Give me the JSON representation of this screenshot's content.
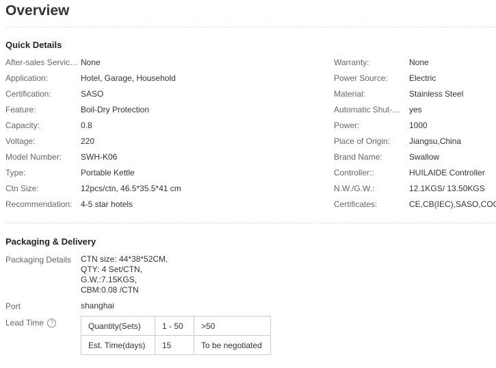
{
  "page_title": "Overview",
  "quick_details": {
    "title": "Quick Details",
    "left": [
      {
        "label": "After-sales Service ...",
        "value": "None"
      },
      {
        "label": "Application:",
        "value": "Hotel, Garage, Household"
      },
      {
        "label": "Certification:",
        "value": "SASO"
      },
      {
        "label": "Feature:",
        "value": "Boil-Dry Protection"
      },
      {
        "label": "Capacity:",
        "value": "0.8"
      },
      {
        "label": "Voltage:",
        "value": "220"
      },
      {
        "label": "Model Number:",
        "value": "SWH-K06"
      },
      {
        "label": "Type:",
        "value": "Portable Kettle"
      },
      {
        "label": "Ctn Size:",
        "value": "12pcs/ctn, 46.5*35.5*41 cm"
      },
      {
        "label": "Recommendation:",
        "value": "4-5 star hotels"
      }
    ],
    "right": [
      {
        "label": "Warranty:",
        "value": "None"
      },
      {
        "label": "Power Source:",
        "value": "Electric"
      },
      {
        "label": "Material:",
        "value": "Stainless Steel"
      },
      {
        "label": "Automatic Shut-off:",
        "value": "yes"
      },
      {
        "label": "Power:",
        "value": "1000"
      },
      {
        "label": "Place of Origin:",
        "value": "Jiangsu,China"
      },
      {
        "label": "Brand Name:",
        "value": "Swallow"
      },
      {
        "label": "Controller::",
        "value": "HUILAIDE Controller"
      },
      {
        "label": "N.W./G.W.:",
        "value": "12.1KGS/ 13.50KGS"
      },
      {
        "label": "Certificates:",
        "value": "CE,CB(IEC),SASO,COC"
      }
    ]
  },
  "packaging": {
    "title": "Packaging & Delivery",
    "details_label": "Packaging Details",
    "details_lines": [
      "CTN size: 44*38*52CM,",
      "QTY: 4 Set/CTN,",
      "G.W.:7.15KGS,",
      "CBM:0.08 /CTN"
    ],
    "port_label": "Port",
    "port_value": "shanghai",
    "lead_time_label": "Lead Time",
    "help_icon": "?",
    "lead_table": {
      "row1": [
        "Quantity(Sets)",
        "1 - 50",
        ">50"
      ],
      "row2": [
        "Est. Time(days)",
        "15",
        "To be negotiated"
      ]
    }
  }
}
